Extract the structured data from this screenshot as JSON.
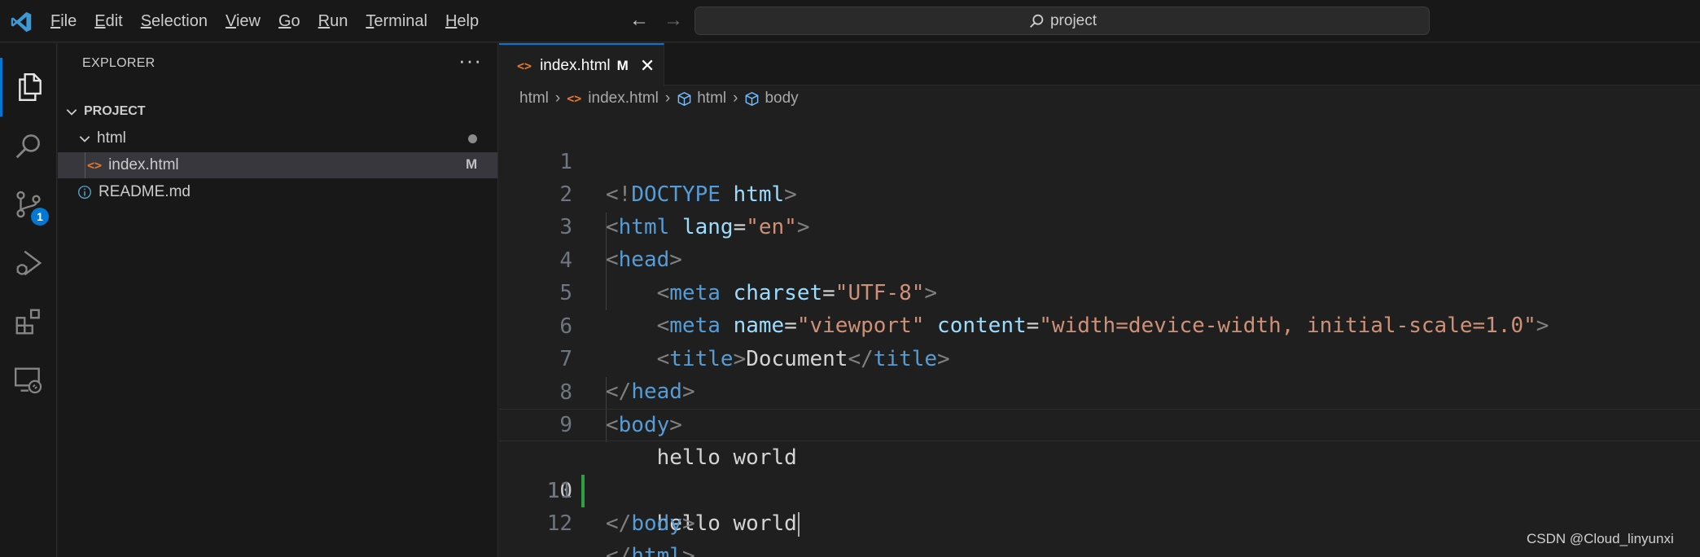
{
  "menu": {
    "items": [
      {
        "label": "File",
        "mnemonic": "F",
        "rest": "ile"
      },
      {
        "label": "Edit",
        "mnemonic": "E",
        "rest": "dit"
      },
      {
        "label": "Selection",
        "mnemonic": "S",
        "rest": "election"
      },
      {
        "label": "View",
        "mnemonic": "V",
        "rest": "iew"
      },
      {
        "label": "Go",
        "mnemonic": "G",
        "rest": "o"
      },
      {
        "label": "Run",
        "mnemonic": "R",
        "rest": "un"
      },
      {
        "label": "Terminal",
        "mnemonic": "T",
        "rest": "erminal"
      },
      {
        "label": "Help",
        "mnemonic": "H",
        "rest": "elp"
      }
    ]
  },
  "search": {
    "text": "project"
  },
  "activity": {
    "source_control_badge": "1"
  },
  "explorer": {
    "title": "EXPLORER",
    "more": "···",
    "project": "PROJECT",
    "folder": "html",
    "file": "index.html",
    "file_status": "M",
    "readme": "README.md"
  },
  "tab": {
    "label": "index.html",
    "status": "M",
    "close": "✕"
  },
  "breadcrumb": {
    "folder": "html",
    "file": "index.html",
    "el1": "html",
    "el2": "body"
  },
  "editor": {
    "line_numbers": [
      "1",
      "2",
      "3",
      "4",
      "5",
      "6",
      "7",
      "8",
      "9",
      "10",
      "11",
      "12"
    ],
    "current_line": "10",
    "lines": [
      "<!DOCTYPE html>",
      "<html lang=\"en\">",
      "<head>",
      "    <meta charset=\"UTF-8\">",
      "    <meta name=\"viewport\" content=\"width=device-width, initial-scale=1.0\">",
      "    <title>Document</title>",
      "</head>",
      "<body>",
      "    hello world",
      "    hello world",
      "</body>",
      "</html>"
    ]
  },
  "watermark": "CSDN @Cloud_linyunxi",
  "colors": {
    "accent": "#0078d4",
    "modified": "#2ea043",
    "html_icon": "#e37933"
  }
}
